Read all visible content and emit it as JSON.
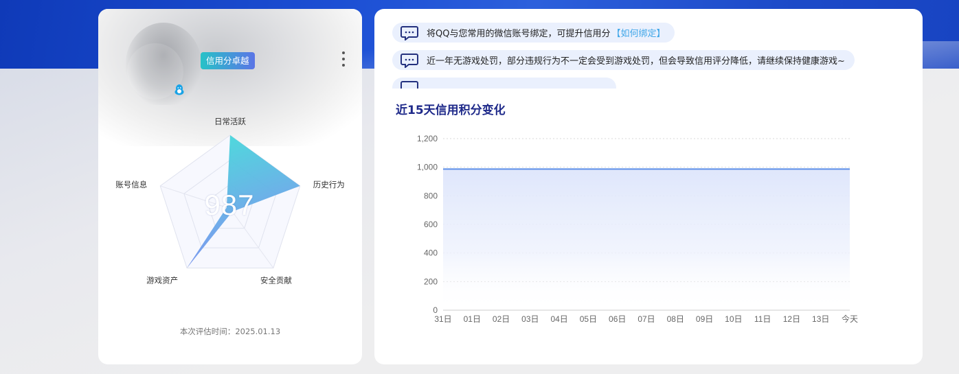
{
  "left_card": {
    "badge": "信用分卓越",
    "score": "987",
    "eval_label": "本次评估时间：",
    "eval_date": "2025.01.13",
    "radar": {
      "axes": [
        "日常活跃",
        "历史行为",
        "安全贡献",
        "游戏资产",
        "账号信息"
      ],
      "values": [
        1.0,
        1.0,
        0.0,
        1.0,
        0.0
      ]
    }
  },
  "notices": [
    {
      "text": "将QQ与您常用的微信账号绑定，可提升信用分",
      "link": "【如何绑定】",
      "icon": "message-icon"
    },
    {
      "text": "近一年无游戏处罚，部分违规行为不一定会受到游戏处罚，但会导致信用评分降低，请继续保持健康游戏~",
      "link": "",
      "icon": "message-icon"
    },
    {
      "text": "",
      "link": "",
      "icon": "message-icon"
    }
  ],
  "chart_title": "近15天信用积分变化",
  "chart_data": {
    "type": "area",
    "title": "近15天信用积分变化",
    "categories": [
      "31日",
      "01日",
      "02日",
      "03日",
      "04日",
      "05日",
      "06日",
      "07日",
      "08日",
      "09日",
      "10日",
      "11日",
      "12日",
      "13日",
      "今天"
    ],
    "values": [
      987,
      987,
      987,
      987,
      987,
      987,
      987,
      987,
      987,
      987,
      987,
      987,
      987,
      987,
      987
    ],
    "ylim": [
      0,
      1200
    ],
    "yticks": [
      0,
      200,
      400,
      600,
      800,
      1000,
      1200
    ],
    "ytick_labels": [
      "0",
      "200",
      "400",
      "600",
      "800",
      "1,000",
      "1,200"
    ],
    "colors": {
      "line": "#5b8de8",
      "fill_top": "#dfe6fb"
    }
  }
}
